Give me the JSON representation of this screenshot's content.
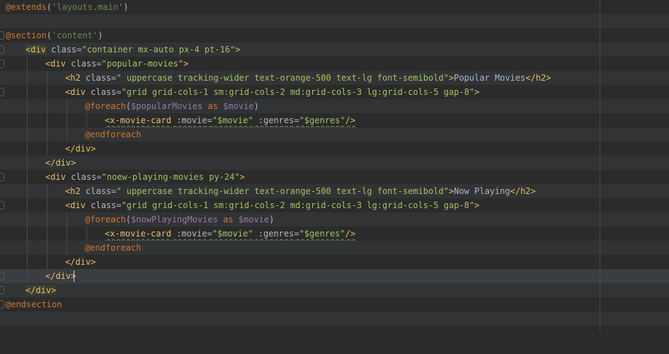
{
  "colors": {
    "background": "#2b2b2b",
    "directive": "#cc7832",
    "tag": "#e8bf6a",
    "string": "#a5c261",
    "text": "#a9b7c6",
    "variable": "#9876aa"
  },
  "lines": {
    "l1": {
      "a": "@extends",
      "b": "(",
      "c": "'layouts.main'",
      "d": ")"
    },
    "l3": {
      "a": "@section",
      "b": "(",
      "c": "'content'",
      "d": ")"
    },
    "l4": {
      "o": "<",
      "tag": "div",
      "attr": " class",
      "eq": "=",
      "val": "\"container mx-auto px-4 pt-16\"",
      "c": ">"
    },
    "l5": {
      "o": "<",
      "tag": "div",
      "attr": " class",
      "eq": "=",
      "val": "\"popular-movies\"",
      "c": ">"
    },
    "l6": {
      "o": "<",
      "tag": "h2",
      "attr": " class",
      "eq": "=",
      "val": "\" uppercase tracking-wider text-orange-500 text-lg font-semibold\"",
      "c": ">",
      "text": "Popular Movies",
      "co": "</",
      "ctag": "h2",
      "cc": ">"
    },
    "l7": {
      "o": "<",
      "tag": "div",
      "attr": " class",
      "eq": "=",
      "val": "\"grid grid-cols-1 sm:grid-cols-2 md:grid-cols-3 lg:grid-cols-5 gap-8\"",
      "c": ">"
    },
    "l8": {
      "a": "@foreach",
      "b": "(",
      "v1": "$popularMovies",
      "k": " as ",
      "v2": "$movie",
      "d": ")"
    },
    "l9": {
      "o": "<",
      "tag": "x-movie-card",
      "attr1": " :movie",
      "eq1": "=",
      "val1": "\"$movie\"",
      "attr2": " :genres",
      "eq2": "=",
      "val2": "\"$genres\"",
      "c": "/>"
    },
    "l10": {
      "a": "@endforeach"
    },
    "l11": {
      "o": "</",
      "tag": "div",
      "c": ">"
    },
    "l12": {
      "o": "</",
      "tag": "div",
      "c": ">"
    },
    "l13": {
      "o": "<",
      "tag": "div",
      "attr": " class",
      "eq": "=",
      "val": "\"noew-playing-movies py-24\"",
      "c": ">"
    },
    "l14": {
      "o": "<",
      "tag": "h2",
      "attr": " class",
      "eq": "=",
      "val": "\" uppercase tracking-wider text-orange-500 text-lg font-semibold\"",
      "c": ">",
      "text": "Now Playing",
      "co": "</",
      "ctag": "h2",
      "cc": ">"
    },
    "l15": {
      "o": "<",
      "tag": "div",
      "attr": " class",
      "eq": "=",
      "val": "\"grid grid-cols-1 sm:grid-cols-2 md:grid-cols-3 lg:grid-cols-5 gap-8\"",
      "c": ">"
    },
    "l16": {
      "a": "@foreach",
      "b": "(",
      "v1": "$nowPlayingMovies",
      "k": " as ",
      "v2": "$movie",
      "d": ")"
    },
    "l17": {
      "o": "<",
      "tag": "x-movie-card",
      "attr1": " :movie",
      "eq1": "=",
      "val1": "\"$movie\"",
      "attr2": " :genres",
      "eq2": "=",
      "val2": "\"$genres\"",
      "c": "/>"
    },
    "l18": {
      "a": "@endforeach"
    },
    "l19": {
      "o": "</",
      "tag": "div",
      "c": ">"
    },
    "l20": {
      "o": "</",
      "tag": "div",
      "c": ">"
    },
    "l21": {
      "o": "</",
      "tag": "div",
      "c": ">"
    },
    "l22": {
      "a": "@endsection"
    }
  }
}
